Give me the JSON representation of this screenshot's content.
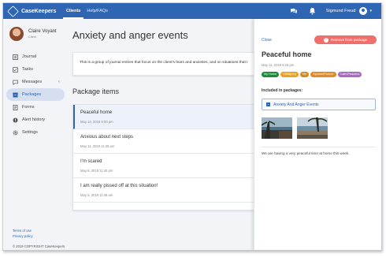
{
  "topbar": {
    "brand": "CaseKeepers",
    "nav": [
      {
        "label": "Clients",
        "active": true
      },
      {
        "label": "Help/FAQs",
        "active": false
      }
    ],
    "user_name": "Sigmund Freud",
    "icons": [
      "chat-icon",
      "bell-icon",
      "user-avatar-icon",
      "chevron-down-icon"
    ]
  },
  "sidebar": {
    "profile": {
      "name": "Claire Voyant",
      "role": "Client"
    },
    "items": [
      {
        "label": "Journal",
        "icon": "journal-icon",
        "active": false
      },
      {
        "label": "Tasks",
        "icon": "tasks-icon",
        "active": false
      },
      {
        "label": "Messages",
        "icon": "messages-icon",
        "active": false,
        "chevron": "‹"
      },
      {
        "label": "Packages",
        "icon": "packages-icon",
        "active": true
      },
      {
        "label": "Forms",
        "icon": "forms-icon",
        "active": false
      },
      {
        "label": "Alert history",
        "icon": "alert-icon",
        "active": false
      },
      {
        "label": "Settings",
        "icon": "settings-icon",
        "active": false
      }
    ],
    "footer_links": [
      "Terms of use",
      "Privacy policy"
    ],
    "copyright": "© 2019 COPYRIGHT CaseKeepers"
  },
  "main": {
    "title": "Anxiety and anger events",
    "description": "This is a group of journal entries that focus on the client's fears and anxieties, and on situations that t",
    "section_title": "Package items",
    "items": [
      {
        "title": "Peaceful home",
        "date": "May 12, 2019 6:00 pm",
        "selected": true
      },
      {
        "title": "Anxious about next steps",
        "date": "May 11, 2019 11:48 am",
        "selected": false
      },
      {
        "title": "I'm scared",
        "date": "May 6, 2019 11:40 pm",
        "selected": false
      },
      {
        "title": "I am really pissed off at this situation!",
        "date": "May 5, 2019 11:48 am",
        "selected": false
      }
    ]
  },
  "panel": {
    "close_label": "Close",
    "remove_label": "Remove from package",
    "entry_title": "Peaceful home",
    "entry_date": "May 11, 2019 6:15 pm",
    "tags": [
      {
        "label": "My Home",
        "color": "#1f8a3b"
      },
      {
        "label": "Child(ren)",
        "color": "#e8a323"
      },
      {
        "label": "Me",
        "color": "#d48a1f"
      },
      {
        "label": "Spouse/Partner",
        "color": "#e08a2a"
      },
      {
        "label": "Calm/Peaceful",
        "color": "#a86bc0"
      }
    ],
    "included_label": "Included in packages:",
    "package_name": "Anxiety And Anger Events",
    "entry_text": "We are having a very peaceful time at home this week."
  },
  "colors": {
    "brand": "#2f66b3",
    "danger": "#ef6f6c",
    "sidebar_active": "#d5dff0"
  }
}
